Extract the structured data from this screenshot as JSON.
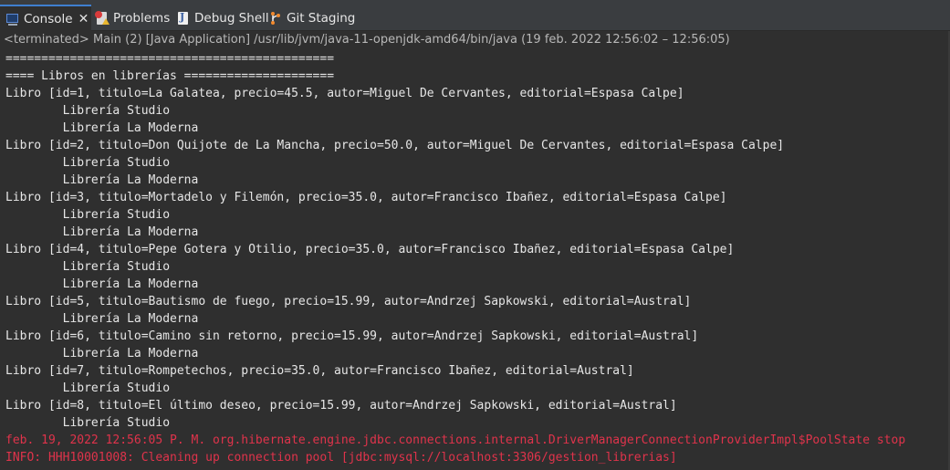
{
  "tabs": [
    {
      "label": "Console",
      "icon": "console-icon",
      "active": true,
      "closable": true
    },
    {
      "label": "Problems",
      "icon": "problems-icon"
    },
    {
      "label": "Debug Shell",
      "icon": "debug-shell-icon"
    },
    {
      "label": "Git Staging",
      "icon": "git-staging-icon"
    }
  ],
  "console": {
    "status": "<terminated> Main (2) [Java Application] /usr/lib/jvm/java-11-openjdk-amd64/bin/java  (19 feb. 2022 12:56:02 – 12:56:05)",
    "lines": [
      {
        "text": "==============================================",
        "type": "out"
      },
      {
        "text": "==== Libros en librerías =====================",
        "type": "out"
      },
      {
        "text": "Libro [id=1, titulo=La Galatea, precio=45.5, autor=Miguel De Cervantes, editorial=Espasa Calpe]",
        "type": "out"
      },
      {
        "text": "\tLibrería Studio",
        "type": "out"
      },
      {
        "text": "\tLibrería La Moderna",
        "type": "out"
      },
      {
        "text": "Libro [id=2, titulo=Don Quijote de La Mancha, precio=50.0, autor=Miguel De Cervantes, editorial=Espasa Calpe]",
        "type": "out"
      },
      {
        "text": "\tLibrería Studio",
        "type": "out"
      },
      {
        "text": "\tLibrería La Moderna",
        "type": "out"
      },
      {
        "text": "Libro [id=3, titulo=Mortadelo y Filemón, precio=35.0, autor=Francisco Ibañez, editorial=Espasa Calpe]",
        "type": "out"
      },
      {
        "text": "\tLibrería Studio",
        "type": "out"
      },
      {
        "text": "\tLibrería La Moderna",
        "type": "out"
      },
      {
        "text": "Libro [id=4, titulo=Pepe Gotera y Otilio, precio=35.0, autor=Francisco Ibañez, editorial=Espasa Calpe]",
        "type": "out"
      },
      {
        "text": "\tLibrería Studio",
        "type": "out"
      },
      {
        "text": "\tLibrería La Moderna",
        "type": "out"
      },
      {
        "text": "Libro [id=5, titulo=Bautismo de fuego, precio=15.99, autor=Andrzej Sapkowski, editorial=Austral]",
        "type": "out"
      },
      {
        "text": "\tLibrería La Moderna",
        "type": "out"
      },
      {
        "text": "Libro [id=6, titulo=Camino sin retorno, precio=15.99, autor=Andrzej Sapkowski, editorial=Austral]",
        "type": "out"
      },
      {
        "text": "\tLibrería La Moderna",
        "type": "out"
      },
      {
        "text": "Libro [id=7, titulo=Rompetechos, precio=35.0, autor=Francisco Ibañez, editorial=Austral]",
        "type": "out"
      },
      {
        "text": "\tLibrería Studio",
        "type": "out"
      },
      {
        "text": "Libro [id=8, titulo=El último deseo, precio=15.99, autor=Andrzej Sapkowski, editorial=Austral]",
        "type": "out"
      },
      {
        "text": "\tLibrería Studio",
        "type": "out"
      },
      {
        "text": "feb. 19, 2022 12:56:05 P. M. org.hibernate.engine.jdbc.connections.internal.DriverManagerConnectionProviderImpl$PoolState stop",
        "type": "err"
      },
      {
        "text": "INFO: HHH10001008: Cleaning up connection pool [jdbc:mysql://localhost:3306/gestion_librerias]",
        "type": "err"
      }
    ]
  },
  "colors": {
    "background": "#2f2f2f",
    "stdout": "#e6e6e6",
    "stderr": "#e0334b",
    "active_tab_accent": "#3f7fd0"
  }
}
